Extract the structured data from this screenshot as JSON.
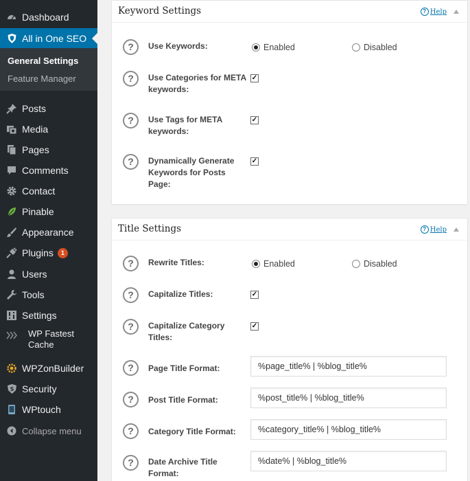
{
  "sidebar": {
    "dashboard": "Dashboard",
    "aioseo": "All in One SEO",
    "submenu": [
      "General Settings",
      "Feature Manager"
    ],
    "posts": "Posts",
    "media": "Media",
    "pages": "Pages",
    "comments": "Comments",
    "contact": "Contact",
    "pinable": "Pinable",
    "appearance": "Appearance",
    "plugins": "Plugins",
    "plugins_badge": "1",
    "users": "Users",
    "tools": "Tools",
    "settings": "Settings",
    "wpfc_line1": "WP Fastest",
    "wpfc_line2": "Cache",
    "wpzon": "WPZonBuilder",
    "security": "Security",
    "wptouch": "WPtouch",
    "collapse": "Collapse menu"
  },
  "keyword": {
    "title": "Keyword Settings",
    "help": "Help",
    "use_keywords": "Use Keywords:",
    "enabled": "Enabled",
    "disabled": "Disabled",
    "use_categories": "Use Categories for META keywords:",
    "use_tags": "Use Tags for META keywords:",
    "dynamic": "Dynamically Generate Keywords for Posts Page:"
  },
  "title_settings": {
    "title": "Title Settings",
    "help": "Help",
    "rewrite": "Rewrite Titles:",
    "enabled": "Enabled",
    "disabled": "Disabled",
    "capitalize": "Capitalize Titles:",
    "capitalize_cat": "Capitalize Category Titles:",
    "page_format_label": "Page Title Format:",
    "page_format_value": "%page_title% | %blog_title%",
    "post_format_label": "Post Title Format:",
    "post_format_value": "%post_title% | %blog_title%",
    "cat_format_label": "Category Title Format:",
    "cat_format_value": "%category_title% | %blog_title%",
    "date_format_label": "Date Archive Title Format:",
    "date_format_value": "%date% | %blog_title%"
  },
  "state": {
    "use_keywords": "enabled",
    "use_categories": true,
    "use_tags": true,
    "dynamic": true,
    "rewrite_titles": "enabled",
    "capitalize": true,
    "capitalize_cat": true
  },
  "icons": [
    "dashboard-icon",
    "shield-icon",
    "pin-icon",
    "media-icon",
    "pages-icon",
    "comment-icon",
    "gear-icon",
    "leaf-icon",
    "brush-icon",
    "plug-icon",
    "user-icon",
    "wrench-icon",
    "settings-icon",
    "cache-icon",
    "zon-icon",
    "security-icon",
    "phone-icon",
    "collapse-icon",
    "question-icon",
    "up-arrow-icon"
  ],
  "colors": {
    "sidebar": "#23282d",
    "active": "#0073aa",
    "submenu": "#32373c",
    "badge": "#d54e21",
    "link": "#0073aa"
  }
}
